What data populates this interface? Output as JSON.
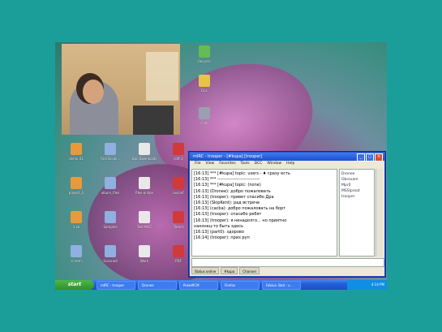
{
  "desktop_icons": [
    {
      "label": "Recycle",
      "color": "#66bb55",
      "pos": "top"
    },
    {
      "label": "Doc",
      "color": "#e8c34a",
      "pos": "top2"
    },
    {
      "label": "Cam",
      "color": "#9aa0b0",
      "pos": "top3"
    }
  ],
  "left_icons": [
    {
      "label": "demo 01",
      "color": "#e79a3c"
    },
    {
      "label": "Fine Deskr...",
      "color": "#8fb0e0"
    },
    {
      "label": "Doc Downloads",
      "color": "#e8e8e8"
    },
    {
      "label": "soft-1",
      "color": "#d03a3a"
    },
    {
      "label": "project_S",
      "color": "#e79a3c"
    },
    {
      "label": "album_files",
      "color": "#8fb0e0"
    },
    {
      "label": "files-online",
      "color": "#e8e8e8"
    },
    {
      "label": "avconf",
      "color": "#d03a3a"
    },
    {
      "label": "1.xe",
      "color": "#e79a3c"
    },
    {
      "label": "Samples",
      "color": "#8fb0e0"
    },
    {
      "label": "Test-MCC",
      "color": "#e8e8e8"
    },
    {
      "label": "Torent",
      "color": "#d03a3a"
    },
    {
      "label": "screen",
      "color": "#8fb0e0"
    },
    {
      "label": "Scanned",
      "color": "#8fb0e0"
    },
    {
      "label": "Work",
      "color": "#e8e8e8"
    },
    {
      "label": "PDF",
      "color": "#d03a3a"
    }
  ],
  "chat_window": {
    "title": "mIRC - trooper - [#kupa] [trooper]",
    "menu": [
      "File",
      "View",
      "Favorites",
      "Tools",
      "DCC",
      "Window",
      "Help"
    ],
    "lines": [
      "[16:13] *** [#kupa] topic: users - ♦ сразу есть",
      "[16:13] *** -----------------------------",
      "[16:13] *** [#kupa] topic: (none)",
      "[16:13] (Dronee): добро пожаловать",
      "[16:13] (trooper): привет спасибо Дра",
      "[16:13] (SkipKent): рад встрече",
      "[16:13] (cacba): добро пожаловать на борт",
      "[16:13] (trooper): спасибо ребят",
      "[16:13] (trooper): я ненадолго... но приятно",
      "  наконец-то быть здесь",
      "[16:13] (part0): здорово",
      "[16:14] (trooper): приз руп"
    ],
    "nicks": [
      "Dronee",
      "Obrexam",
      "Mpr0",
      "MSSlproot",
      "trooper"
    ],
    "switchbar": [
      "Status online",
      "#kupa",
      "Channel"
    ]
  },
  "taskbar": {
    "start_label": "start",
    "tasks": [
      "mIRC - trooper",
      "Dronee",
      "PokeWCM",
      "Firefox",
      "Fabius: Bait - v..."
    ],
    "clock": "4:14 PM"
  }
}
